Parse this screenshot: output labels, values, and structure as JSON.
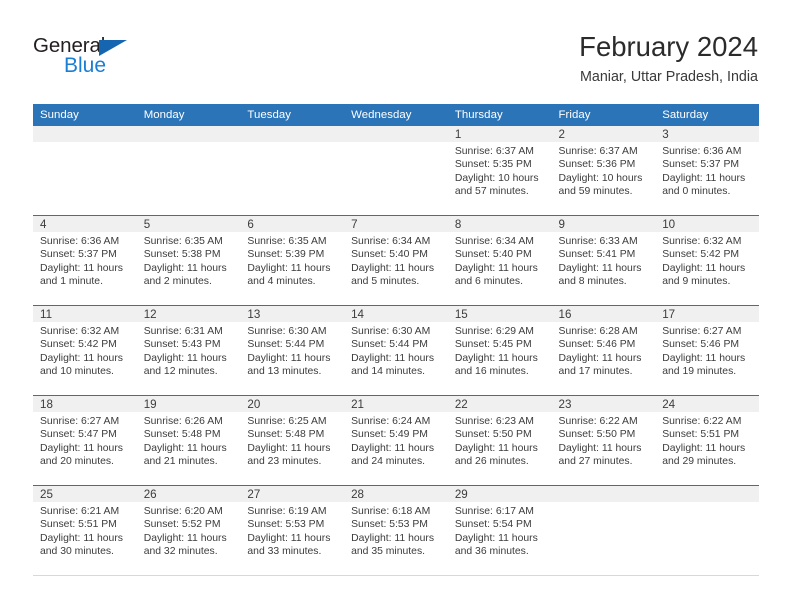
{
  "brand": {
    "logo_line1": "General",
    "logo_line2": "Blue",
    "logo_icon": "triangle-icon",
    "color_dark": "#231f20",
    "color_blue": "#1a7fd4"
  },
  "header": {
    "title": "February 2024",
    "subtitle": "Maniar, Uttar Pradesh, India"
  },
  "theme": {
    "header_bg": "#2b74b8",
    "daynum_bg": "#f0f0f0",
    "row_divider": "#2b74b8",
    "text": "#3c3c3c"
  },
  "calendar": {
    "weekday_headers": [
      "Sunday",
      "Monday",
      "Tuesday",
      "Wednesday",
      "Thursday",
      "Friday",
      "Saturday"
    ],
    "weeks": [
      [
        {
          "day": "",
          "lines": []
        },
        {
          "day": "",
          "lines": []
        },
        {
          "day": "",
          "lines": []
        },
        {
          "day": "",
          "lines": []
        },
        {
          "day": "1",
          "lines": [
            "Sunrise: 6:37 AM",
            "Sunset: 5:35 PM",
            "Daylight: 10 hours",
            "and 57 minutes."
          ]
        },
        {
          "day": "2",
          "lines": [
            "Sunrise: 6:37 AM",
            "Sunset: 5:36 PM",
            "Daylight: 10 hours",
            "and 59 minutes."
          ]
        },
        {
          "day": "3",
          "lines": [
            "Sunrise: 6:36 AM",
            "Sunset: 5:37 PM",
            "Daylight: 11 hours",
            "and 0 minutes."
          ]
        }
      ],
      [
        {
          "day": "4",
          "lines": [
            "Sunrise: 6:36 AM",
            "Sunset: 5:37 PM",
            "Daylight: 11 hours",
            "and 1 minute."
          ]
        },
        {
          "day": "5",
          "lines": [
            "Sunrise: 6:35 AM",
            "Sunset: 5:38 PM",
            "Daylight: 11 hours",
            "and 2 minutes."
          ]
        },
        {
          "day": "6",
          "lines": [
            "Sunrise: 6:35 AM",
            "Sunset: 5:39 PM",
            "Daylight: 11 hours",
            "and 4 minutes."
          ]
        },
        {
          "day": "7",
          "lines": [
            "Sunrise: 6:34 AM",
            "Sunset: 5:40 PM",
            "Daylight: 11 hours",
            "and 5 minutes."
          ]
        },
        {
          "day": "8",
          "lines": [
            "Sunrise: 6:34 AM",
            "Sunset: 5:40 PM",
            "Daylight: 11 hours",
            "and 6 minutes."
          ]
        },
        {
          "day": "9",
          "lines": [
            "Sunrise: 6:33 AM",
            "Sunset: 5:41 PM",
            "Daylight: 11 hours",
            "and 8 minutes."
          ]
        },
        {
          "day": "10",
          "lines": [
            "Sunrise: 6:32 AM",
            "Sunset: 5:42 PM",
            "Daylight: 11 hours",
            "and 9 minutes."
          ]
        }
      ],
      [
        {
          "day": "11",
          "lines": [
            "Sunrise: 6:32 AM",
            "Sunset: 5:42 PM",
            "Daylight: 11 hours",
            "and 10 minutes."
          ]
        },
        {
          "day": "12",
          "lines": [
            "Sunrise: 6:31 AM",
            "Sunset: 5:43 PM",
            "Daylight: 11 hours",
            "and 12 minutes."
          ]
        },
        {
          "day": "13",
          "lines": [
            "Sunrise: 6:30 AM",
            "Sunset: 5:44 PM",
            "Daylight: 11 hours",
            "and 13 minutes."
          ]
        },
        {
          "day": "14",
          "lines": [
            "Sunrise: 6:30 AM",
            "Sunset: 5:44 PM",
            "Daylight: 11 hours",
            "and 14 minutes."
          ]
        },
        {
          "day": "15",
          "lines": [
            "Sunrise: 6:29 AM",
            "Sunset: 5:45 PM",
            "Daylight: 11 hours",
            "and 16 minutes."
          ]
        },
        {
          "day": "16",
          "lines": [
            "Sunrise: 6:28 AM",
            "Sunset: 5:46 PM",
            "Daylight: 11 hours",
            "and 17 minutes."
          ]
        },
        {
          "day": "17",
          "lines": [
            "Sunrise: 6:27 AM",
            "Sunset: 5:46 PM",
            "Daylight: 11 hours",
            "and 19 minutes."
          ]
        }
      ],
      [
        {
          "day": "18",
          "lines": [
            "Sunrise: 6:27 AM",
            "Sunset: 5:47 PM",
            "Daylight: 11 hours",
            "and 20 minutes."
          ]
        },
        {
          "day": "19",
          "lines": [
            "Sunrise: 6:26 AM",
            "Sunset: 5:48 PM",
            "Daylight: 11 hours",
            "and 21 minutes."
          ]
        },
        {
          "day": "20",
          "lines": [
            "Sunrise: 6:25 AM",
            "Sunset: 5:48 PM",
            "Daylight: 11 hours",
            "and 23 minutes."
          ]
        },
        {
          "day": "21",
          "lines": [
            "Sunrise: 6:24 AM",
            "Sunset: 5:49 PM",
            "Daylight: 11 hours",
            "and 24 minutes."
          ]
        },
        {
          "day": "22",
          "lines": [
            "Sunrise: 6:23 AM",
            "Sunset: 5:50 PM",
            "Daylight: 11 hours",
            "and 26 minutes."
          ]
        },
        {
          "day": "23",
          "lines": [
            "Sunrise: 6:22 AM",
            "Sunset: 5:50 PM",
            "Daylight: 11 hours",
            "and 27 minutes."
          ]
        },
        {
          "day": "24",
          "lines": [
            "Sunrise: 6:22 AM",
            "Sunset: 5:51 PM",
            "Daylight: 11 hours",
            "and 29 minutes."
          ]
        }
      ],
      [
        {
          "day": "25",
          "lines": [
            "Sunrise: 6:21 AM",
            "Sunset: 5:51 PM",
            "Daylight: 11 hours",
            "and 30 minutes."
          ]
        },
        {
          "day": "26",
          "lines": [
            "Sunrise: 6:20 AM",
            "Sunset: 5:52 PM",
            "Daylight: 11 hours",
            "and 32 minutes."
          ]
        },
        {
          "day": "27",
          "lines": [
            "Sunrise: 6:19 AM",
            "Sunset: 5:53 PM",
            "Daylight: 11 hours",
            "and 33 minutes."
          ]
        },
        {
          "day": "28",
          "lines": [
            "Sunrise: 6:18 AM",
            "Sunset: 5:53 PM",
            "Daylight: 11 hours",
            "and 35 minutes."
          ]
        },
        {
          "day": "29",
          "lines": [
            "Sunrise: 6:17 AM",
            "Sunset: 5:54 PM",
            "Daylight: 11 hours",
            "and 36 minutes."
          ]
        },
        {
          "day": "",
          "lines": []
        },
        {
          "day": "",
          "lines": []
        }
      ]
    ]
  }
}
